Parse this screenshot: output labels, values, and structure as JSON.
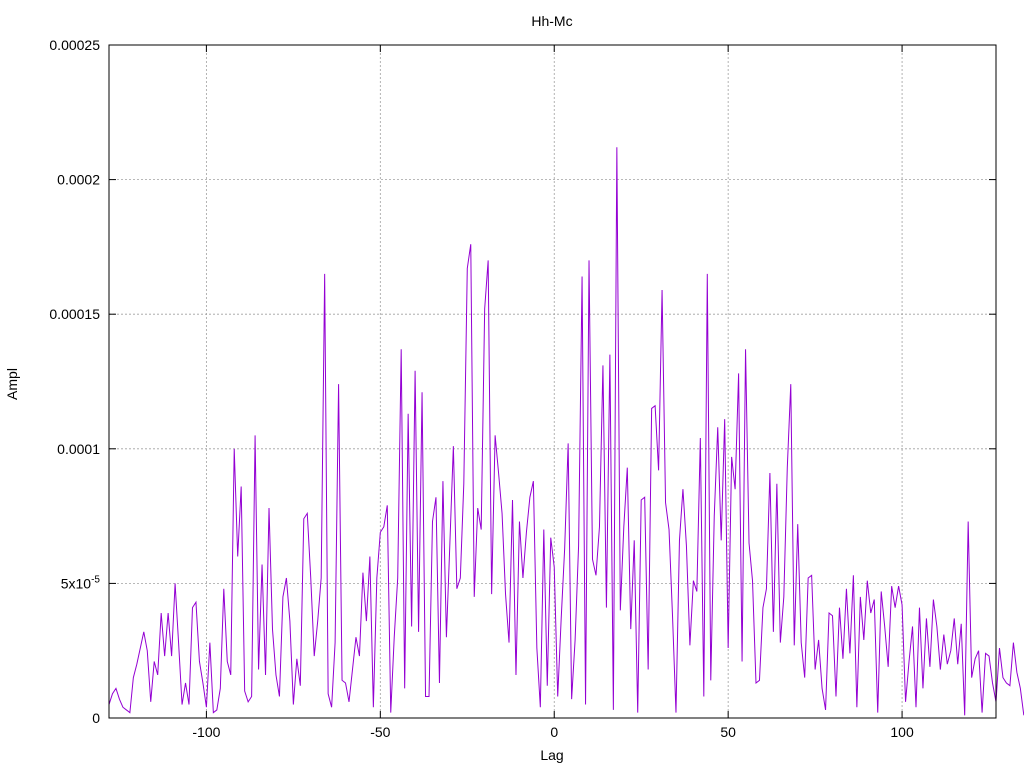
{
  "chart_data": {
    "type": "line",
    "title": "Hh-Mc",
    "xlabel": "Lag",
    "ylabel": "Ampl",
    "xlim": [
      -128,
      127
    ],
    "ylim": [
      0,
      0.00025
    ],
    "grid": true,
    "x_ticks": [
      {
        "value": -100,
        "label": "-100"
      },
      {
        "value": -50,
        "label": "-50"
      },
      {
        "value": 0,
        "label": "0"
      },
      {
        "value": 50,
        "label": "50"
      },
      {
        "value": 100,
        "label": "100"
      }
    ],
    "y_ticks": [
      {
        "value": 0,
        "label": "0",
        "exp": ""
      },
      {
        "value": 5e-05,
        "label": "5x10",
        "exp": "-5"
      },
      {
        "value": 0.0001,
        "label": "0.0001",
        "exp": ""
      },
      {
        "value": 0.00015,
        "label": "0.00015",
        "exp": ""
      },
      {
        "value": 0.0002,
        "label": "0.0002",
        "exp": ""
      },
      {
        "value": 0.00025,
        "label": "0.00025",
        "exp": ""
      }
    ],
    "series": [
      {
        "color": "#9400d3",
        "x_start": -128,
        "x_step": 1,
        "values": [
          5e-06,
          9e-06,
          1.1e-05,
          7e-06,
          4e-06,
          3e-06,
          2e-06,
          1.5e-05,
          2e-05,
          2.6e-05,
          3.2e-05,
          2.5e-05,
          6e-06,
          2.1e-05,
          1.6e-05,
          3.9e-05,
          2.3e-05,
          3.9e-05,
          2.3e-05,
          5e-05,
          2.8e-05,
          5e-06,
          1.3e-05,
          5e-06,
          4.1e-05,
          4.3e-05,
          2.1e-05,
          1.3e-05,
          4e-06,
          2.8e-05,
          2e-06,
          3e-06,
          1.1e-05,
          4.8e-05,
          2.1e-05,
          1.6e-05,
          0.0001,
          6e-05,
          8.6e-05,
          1e-05,
          6e-06,
          8e-06,
          0.000105,
          1.8e-05,
          5.7e-05,
          1.6e-05,
          7.8e-05,
          3.3e-05,
          1.6e-05,
          8e-06,
          4.5e-05,
          5.2e-05,
          3.6e-05,
          5e-06,
          2.2e-05,
          1.2e-05,
          7.4e-05,
          7.6e-05,
          5.2e-05,
          2.3e-05,
          3.6e-05,
          5.2e-05,
          0.000165,
          9e-06,
          4e-06,
          2.8e-05,
          0.000124,
          1.4e-05,
          1.3e-05,
          6e-06,
          1.8e-05,
          3e-05,
          2.3e-05,
          5.4e-05,
          3.6e-05,
          6e-05,
          4e-06,
          5.2e-05,
          6.9e-05,
          7.1e-05,
          7.9e-05,
          2e-06,
          3e-05,
          5.2e-05,
          0.000137,
          1.1e-05,
          0.000113,
          3.4e-05,
          0.000129,
          3.2e-05,
          0.000121,
          8e-06,
          8e-06,
          7.3e-05,
          8.2e-05,
          1.3e-05,
          8.8e-05,
          3e-05,
          6.5e-05,
          0.000101,
          4.8e-05,
          5.2e-05,
          8.7e-05,
          0.000167,
          0.000176,
          4.5e-05,
          7.8e-05,
          7e-05,
          0.000152,
          0.00017,
          4.6e-05,
          0.000105,
          9.1e-05,
          7.6e-05,
          4.6e-05,
          2.8e-05,
          8.1e-05,
          1.6e-05,
          7.3e-05,
          5.2e-05,
          6.9e-05,
          8.2e-05,
          8.8e-05,
          2.6e-05,
          4e-06,
          7e-05,
          1.2e-05,
          6.7e-05,
          5.6e-05,
          8e-06,
          3.7e-05,
          6.3e-05,
          0.000102,
          7e-06,
          2.9e-05,
          6.4e-05,
          0.000164,
          5e-06,
          0.00017,
          5.9e-05,
          5.3e-05,
          7.1e-05,
          0.000131,
          4.1e-05,
          0.000135,
          3e-06,
          0.000212,
          4e-05,
          7.1e-05,
          9.3e-05,
          3.3e-05,
          6.6e-05,
          2e-06,
          8.1e-05,
          8.2e-05,
          1.8e-05,
          0.000115,
          0.000116,
          9.2e-05,
          0.000159,
          8e-05,
          7e-05,
          3.8e-05,
          2e-06,
          6.6e-05,
          8.5e-05,
          6.4e-05,
          2.7e-05,
          5.1e-05,
          4.7e-05,
          0.000104,
          8e-06,
          0.000165,
          1.4e-05,
          7.5e-05,
          0.000108,
          6.6e-05,
          0.000111,
          2.6e-05,
          9.7e-05,
          8.5e-05,
          0.000128,
          2.1e-05,
          0.000137,
          6.5e-05,
          5.1e-05,
          1.3e-05,
          1.4e-05,
          4.1e-05,
          4.8e-05,
          9.1e-05,
          3.2e-05,
          8.7e-05,
          2.8e-05,
          4.5e-05,
          9.3e-05,
          0.000124,
          2.7e-05,
          7.2e-05,
          2.8e-05,
          1.5e-05,
          5.2e-05,
          5.3e-05,
          1.8e-05,
          2.9e-05,
          1.1e-05,
          3e-06,
          3.9e-05,
          3.8e-05,
          8e-06,
          4.1e-05,
          2.2e-05,
          4.8e-05,
          2.4e-05,
          5.3e-05,
          4e-06,
          4.5e-05,
          2.9e-05,
          5.1e-05,
          3.9e-05,
          4.4e-05,
          2e-06,
          4.7e-05,
          3.4e-05,
          1.9e-05,
          4.9e-05,
          4.1e-05,
          4.9e-05,
          4.2e-05,
          6e-06,
          2.1e-05,
          3.4e-05,
          4e-06,
          4.1e-05,
          1.1e-05,
          3.7e-05,
          1.9e-05,
          4.4e-05,
          3.4e-05,
          1.8e-05,
          3.1e-05,
          2e-05,
          2.5e-05,
          3.7e-05,
          2e-05,
          3.5e-05,
          1e-06,
          7.3e-05,
          1.5e-05,
          2.2e-05,
          2.5e-05,
          2e-06,
          2.4e-05,
          2.3e-05,
          1.3e-05,
          6e-06,
          2.6e-05,
          1.5e-05,
          1.3e-05,
          1.2e-05,
          2.8e-05,
          1.7e-05,
          1.1e-05,
          1e-06
        ]
      }
    ]
  }
}
